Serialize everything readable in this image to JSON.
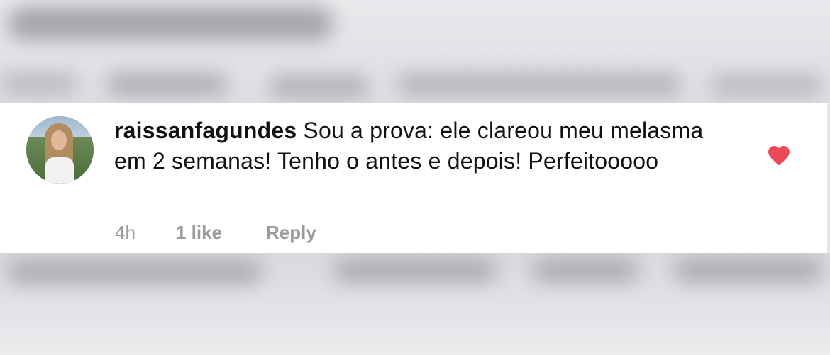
{
  "comment": {
    "username": "raissanfagundes",
    "text": "Sou a prova: ele clareou meu melasma em 2 semanas! Tenho o antes e depois! Perfeitooooo",
    "time": "4h",
    "likes": "1 like",
    "reply_label": "Reply",
    "liked": true,
    "heart_color": "#ed4956"
  },
  "icons": {
    "avatar": "avatar",
    "like": "heart-icon"
  }
}
